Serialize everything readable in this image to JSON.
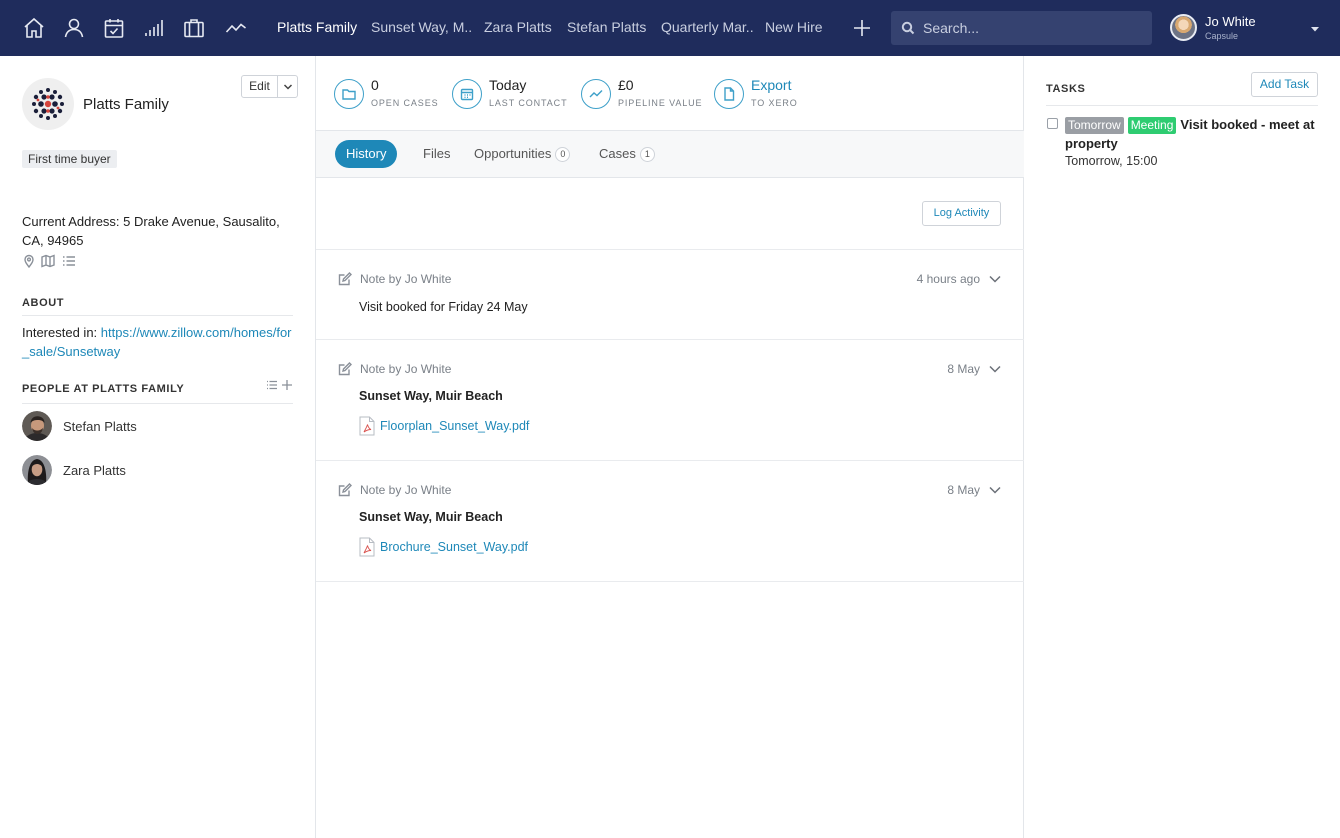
{
  "nav": {
    "icons": [
      "home-icon",
      "person-icon",
      "calendar-check-icon",
      "bars-icon",
      "briefcase-icon",
      "trend-icon"
    ],
    "tabs": [
      {
        "label": "Platts Family",
        "active": true
      },
      {
        "label": "Sunset Way, M.."
      },
      {
        "label": "Zara Platts"
      },
      {
        "label": "Stefan Platts"
      },
      {
        "label": "Quarterly Mar.."
      },
      {
        "label": "New Hire"
      }
    ],
    "search_placeholder": "Search...",
    "user": {
      "name": "Jo White",
      "org": "Capsule"
    }
  },
  "party": {
    "name": "Platts Family",
    "edit_label": "Edit",
    "tag": "First time buyer",
    "address": "Current Address: 5 Drake Avenue, Sausalito, CA, 94965",
    "about_heading": "ABOUT",
    "about_prefix": "Interested in: ",
    "about_link": "https://www.zillow.com/homes/for_sale/Sunsetway",
    "people_heading": "PEOPLE AT PLATTS FAMILY",
    "people": [
      {
        "name": "Stefan Platts"
      },
      {
        "name": "Zara Platts"
      }
    ]
  },
  "stats": [
    {
      "value": "0",
      "label": "OPEN CASES",
      "icon": "folder-icon"
    },
    {
      "value": "Today",
      "label": "LAST CONTACT",
      "icon": "calendar-icon"
    },
    {
      "value": "£0",
      "label": "PIPELINE VALUE",
      "icon": "trend-icon"
    },
    {
      "value": "Export",
      "label": "TO XERO",
      "icon": "document-icon"
    }
  ],
  "tabs": [
    {
      "label": "History",
      "active": true
    },
    {
      "label": "Files"
    },
    {
      "label": "Opportunities",
      "count": "0"
    },
    {
      "label": "Cases",
      "count": "1"
    }
  ],
  "log_activity_label": "Log Activity",
  "entries": [
    {
      "author": "Note by Jo White",
      "time": "4 hours ago",
      "body": "Visit booked for Friday 24 May",
      "bold": false
    },
    {
      "author": "Note by Jo White",
      "time": "8 May",
      "body": "Sunset Way, Muir Beach",
      "bold": true,
      "attachment": "Floorplan_Sunset_Way.pdf"
    },
    {
      "author": "Note by Jo White",
      "time": "8 May",
      "body": "Sunset Way, Muir Beach",
      "bold": true,
      "attachment": "Brochure_Sunset_Way.pdf"
    }
  ],
  "tasks": {
    "heading": "TASKS",
    "add_label": "Add Task",
    "items": [
      {
        "badge_when": "Tomorrow",
        "badge_type": "Meeting",
        "title": "Visit booked - meet at property",
        "due": "Tomorrow, 15:00"
      }
    ]
  },
  "colors": {
    "nav_bg": "#1f2c5c",
    "accent": "#1e88b8",
    "meeting_badge": "#2ecc71"
  }
}
